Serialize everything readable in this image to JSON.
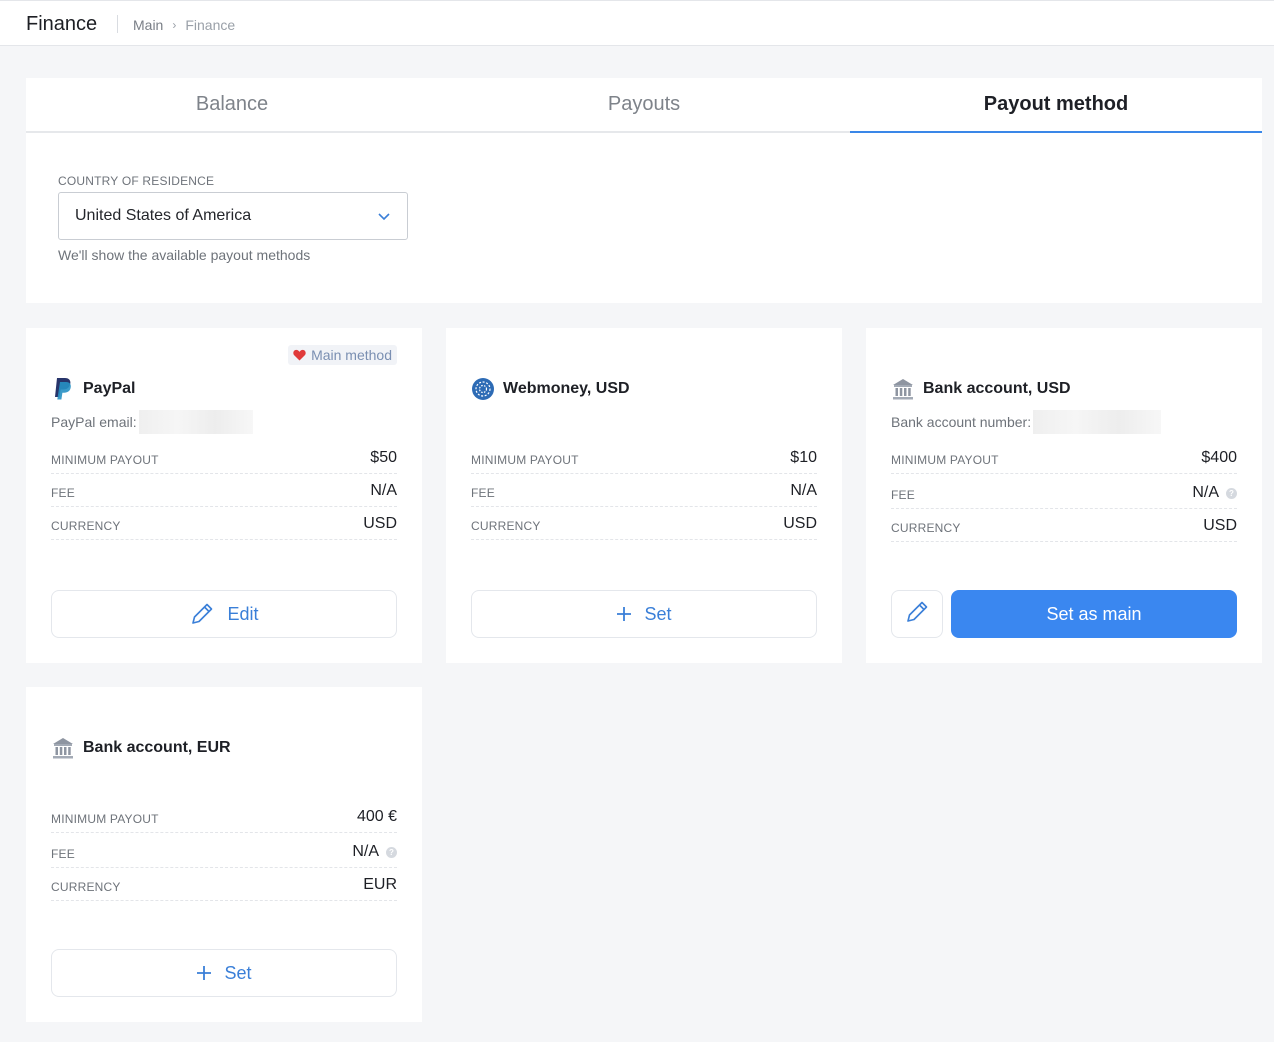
{
  "header": {
    "title": "Finance",
    "breadcrumbs": [
      "Main",
      "Finance"
    ]
  },
  "tabs": [
    {
      "label": "Balance",
      "active": false
    },
    {
      "label": "Payouts",
      "active": false
    },
    {
      "label": "Payout method",
      "active": true
    }
  ],
  "country": {
    "label": "COUNTRY OF RESIDENCE",
    "value": "United States of America",
    "helper": "We'll show the available payout methods"
  },
  "methods": [
    {
      "name": "PayPal",
      "icon": "paypal-icon",
      "badge": "Main method",
      "sub_label": "PayPal email:",
      "rows": [
        {
          "key": "MINIMUM PAYOUT",
          "value": "$50"
        },
        {
          "key": "FEE",
          "value": "N/A"
        },
        {
          "key": "CURRENCY",
          "value": "USD"
        }
      ],
      "action": "Edit"
    },
    {
      "name": "Webmoney, USD",
      "icon": "webmoney-icon",
      "rows": [
        {
          "key": "MINIMUM PAYOUT",
          "value": "$10"
        },
        {
          "key": "FEE",
          "value": "N/A"
        },
        {
          "key": "CURRENCY",
          "value": "USD"
        }
      ],
      "action": "Set"
    },
    {
      "name": "Bank account, USD",
      "icon": "bank-icon",
      "sub_label": "Bank account number:",
      "rows": [
        {
          "key": "MINIMUM PAYOUT",
          "value": "$400"
        },
        {
          "key": "FEE",
          "value": "N/A"
        },
        {
          "key": "CURRENCY",
          "value": "USD"
        }
      ],
      "action": "Set as main"
    },
    {
      "name": "Bank account, EUR",
      "icon": "bank-icon",
      "rows": [
        {
          "key": "MINIMUM PAYOUT",
          "value": "400 €"
        },
        {
          "key": "FEE",
          "value": "N/A"
        },
        {
          "key": "CURRENCY",
          "value": "EUR"
        }
      ],
      "action": "Set"
    }
  ],
  "colors": {
    "accent": "#3a87f0",
    "tab_underline": "#3a87e8",
    "heart": "#e03a3a"
  }
}
